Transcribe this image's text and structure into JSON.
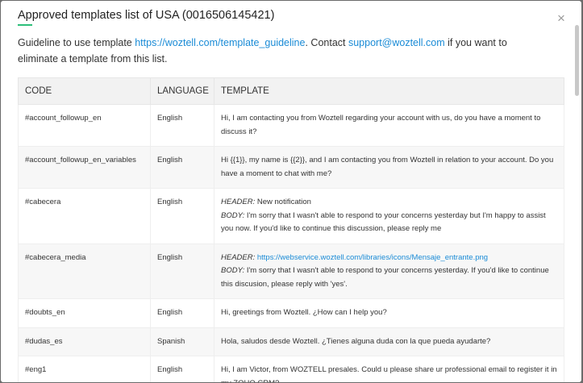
{
  "dialog": {
    "title": "Approved templates list of USA (0016506145421)",
    "close_icon": "×"
  },
  "guideline": {
    "prefix": "Guideline to use template ",
    "link": "https://woztell.com/template_guideline",
    "middle": ". Contact ",
    "email": "support@woztell.com",
    "suffix": " if you want to eliminate a template from this list."
  },
  "table": {
    "headers": {
      "code": "CODE",
      "language": "LANGUAGE",
      "template": "TEMPLATE"
    },
    "rows": [
      {
        "code": "#account_followup_en",
        "language": "English",
        "text": "Hi, I am contacting you from Woztell regarding your account with us, do you have a moment to discuss it?"
      },
      {
        "code": "#account_followup_en_variables",
        "language": "English",
        "text": "Hi {{1}}, my name is {{2}}, and I am contacting you from Woztell in relation to your account. Do you have a moment to chat with me?"
      },
      {
        "code": "#cabecera",
        "language": "English",
        "header_label": "HEADER:",
        "header_value": " New notification",
        "body_label": "BODY:",
        "body_value": " I'm sorry that I wasn't able to respond to your concerns yesterday but I'm happy to assist you now. If you'd like to continue this discussion, please reply me"
      },
      {
        "code": "#cabecera_media",
        "language": "English",
        "header_label": "HEADER:",
        "header_link": "https://webservice.woztell.com/libraries/icons/Mensaje_entrante.png",
        "body_label": "BODY:",
        "body_value": " I'm sorry that I wasn't able to respond to your concerns yesterday. If you'd like to continue this discusion, please reply with 'yes'."
      },
      {
        "code": "#doubts_en",
        "language": "English",
        "text": "Hi, greetings from Woztell. ¿How can I help you?"
      },
      {
        "code": "#dudas_es",
        "language": "Spanish",
        "text": "Hola, saludos desde Woztell. ¿Tienes alguna duda con la que pueda ayudarte?"
      },
      {
        "code": "#eng1",
        "language": "English",
        "text": "Hi, I am Victor, from WOZTELL presales. Could u please share ur professional email to register it in my ZOHO CRM?"
      }
    ]
  }
}
